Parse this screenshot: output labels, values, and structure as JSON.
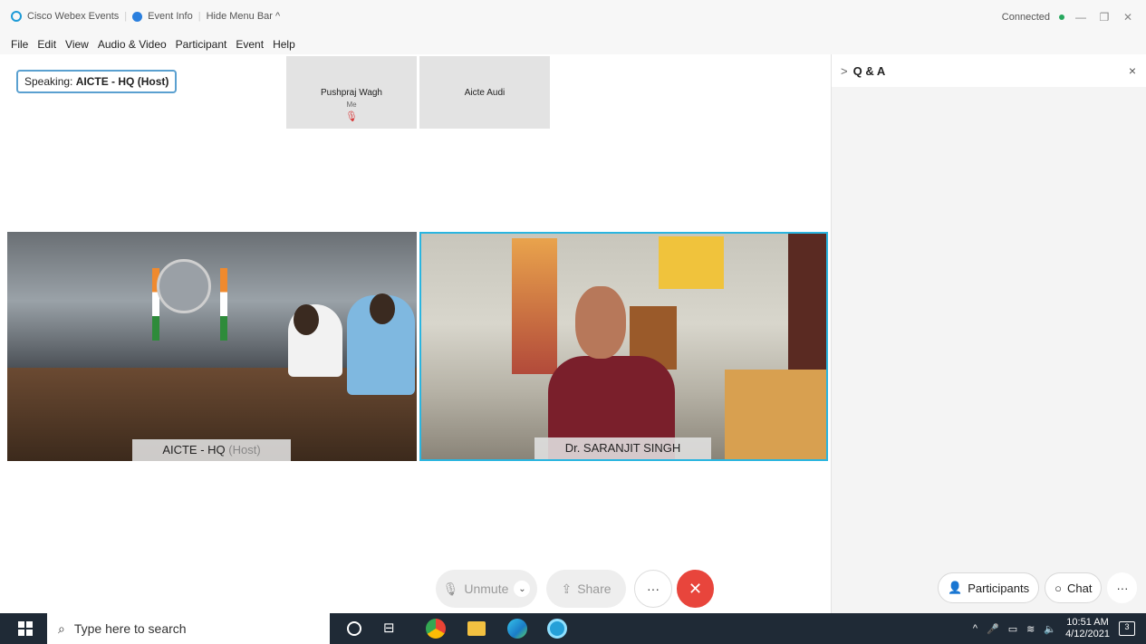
{
  "titlebar": {
    "app_name": "Cisco Webex Events",
    "event_info": "Event Info",
    "hide_menu": "Hide Menu Bar ^",
    "status": "Connected",
    "minimize": "—",
    "restore": "❐",
    "close": "✕"
  },
  "menu": {
    "items": [
      "File",
      "Edit",
      "View",
      "Audio & Video",
      "Participant",
      "Event",
      "Help"
    ]
  },
  "stage": {
    "speaking_prefix": "Speaking:",
    "speaking_name": "AICTE - HQ (Host)",
    "thumbnails": [
      {
        "name": "Pushpraj Wagh",
        "sub": "Me",
        "mic": "🎙"
      },
      {
        "name": "Aicte Audi"
      }
    ],
    "videos": [
      {
        "name": "AICTE - HQ",
        "role": "(Host)"
      },
      {
        "name": "Dr. SARANJIT SINGH"
      }
    ]
  },
  "controls": {
    "unmute": "Unmute",
    "unmute_icon": "mic-off-icon",
    "share": "Share",
    "share_icon": "share-icon",
    "more": "···",
    "leave": "✕"
  },
  "panel": {
    "title": "Q & A",
    "expand": ">",
    "close": "×"
  },
  "right_controls": {
    "participants": "Participants",
    "chat": "Chat",
    "more": "···"
  },
  "taskbar": {
    "search_placeholder": "Type here to search",
    "time": "10:51 AM",
    "date": "4/12/2021",
    "notifications": "3"
  },
  "colors": {
    "accent": "#2ab5e0",
    "leave": "#e8453c",
    "connected": "#27a85e",
    "taskbar": "#1f2a36"
  }
}
